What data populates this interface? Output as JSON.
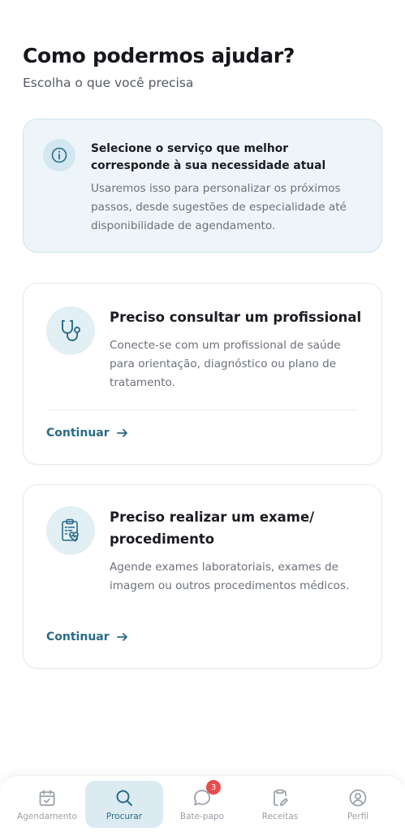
{
  "header": {
    "title": "Como podermos ajudar?",
    "subtitle": "Escolha o que você precisa"
  },
  "info": {
    "title": "Selecione o serviço que melhor corresponde à sua necessidade atual",
    "body": "Usaremos isso para personalizar os próximos passos, desde sugestões de especialidade até disponibilidade de agendamento."
  },
  "options": [
    {
      "title": "Preciso consultar um profissional",
      "description": "Conecte-se com um profissional de saúde para orientação, diagnóstico ou plano de tratamento.",
      "action": "Continuar",
      "icon": "stethoscope-icon"
    },
    {
      "title": "Preciso realizar um exame/ procedimento",
      "description": "Agende exames laboratoriais, exames de imagem ou outros procedimentos médicos.",
      "action": "Continuar",
      "icon": "clipboard-heart-icon"
    }
  ],
  "nav": {
    "items": [
      {
        "label": "Agendamento",
        "icon": "calendar-check-icon"
      },
      {
        "label": "Procurar",
        "icon": "search-icon",
        "active": true
      },
      {
        "label": "Bate-papo",
        "icon": "chat-icon",
        "badge": "3"
      },
      {
        "label": "Receitas",
        "icon": "prescription-icon"
      },
      {
        "label": "Perfil",
        "icon": "profile-icon"
      }
    ]
  },
  "colors": {
    "accent": "#2b6b87",
    "info_background": "#eef5f9",
    "badge": "#e84c4c"
  }
}
